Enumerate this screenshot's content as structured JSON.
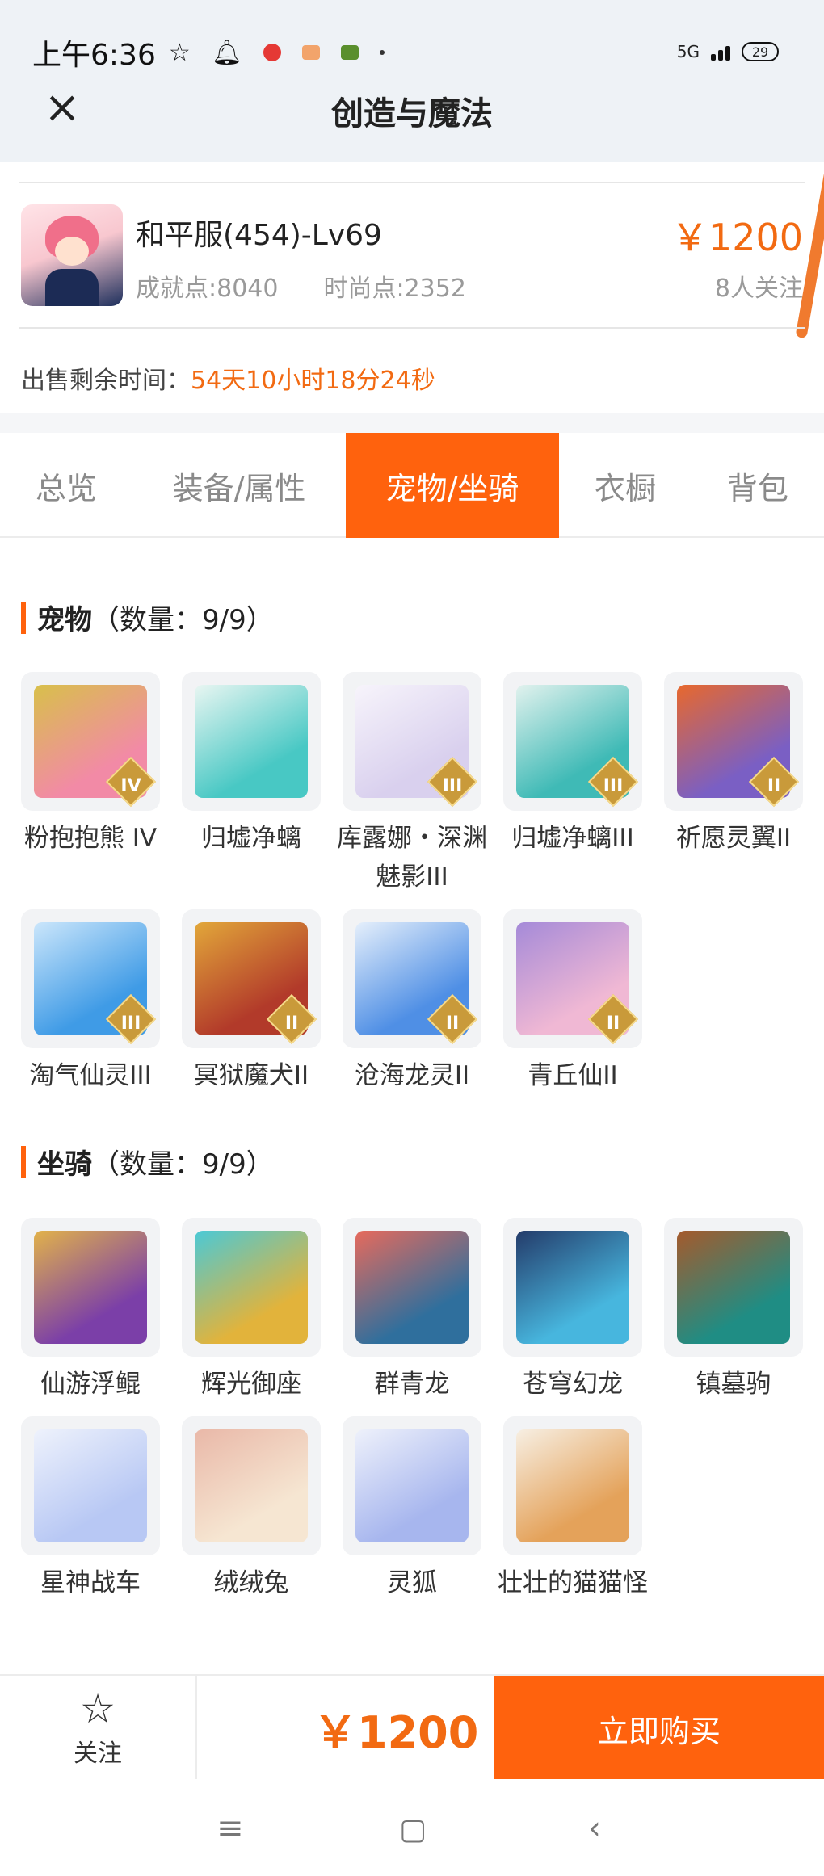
{
  "status_bar": {
    "time": "上午6:36",
    "network": "5G",
    "battery": "29"
  },
  "nav": {
    "title": "创造与魔法"
  },
  "listing": {
    "server": "和平服(454)-Lv69",
    "achievement": "成就点:8040",
    "fashion": "时尚点:2352",
    "price": "￥1200",
    "followers": "8人关注",
    "remain_label": "出售剩余时间：",
    "remain_value": "54天10小时18分24秒"
  },
  "tabs": [
    {
      "label": "总览"
    },
    {
      "label": "装备/属性"
    },
    {
      "label": "宠物/坐骑",
      "active": true
    },
    {
      "label": "衣橱"
    },
    {
      "label": "背包"
    }
  ],
  "pets": {
    "title": "宠物",
    "count": "（数量：9/9）",
    "items": [
      {
        "name": "粉抱抱熊 IV",
        "badge": "IV",
        "colors": [
          "#f28aa6",
          "#d8c04a"
        ]
      },
      {
        "name": "归墟净螭",
        "badge": "",
        "colors": [
          "#48c8c4",
          "#e9f6f2"
        ]
      },
      {
        "name": "库露娜・深渊魅影III",
        "badge": "III",
        "colors": [
          "#d9d0ee",
          "#f7f4fb"
        ]
      },
      {
        "name": "归墟净螭III",
        "badge": "III",
        "colors": [
          "#3fbab6",
          "#e2f2ee"
        ]
      },
      {
        "name": "祈愿灵翼II",
        "badge": "II",
        "colors": [
          "#7a5fc4",
          "#e8682c"
        ]
      },
      {
        "name": "淘气仙灵III",
        "badge": "III",
        "colors": [
          "#3f9be6",
          "#cbe6fb"
        ]
      },
      {
        "name": "冥狱魔犬II",
        "badge": "II",
        "colors": [
          "#b23a2a",
          "#e2a73a"
        ]
      },
      {
        "name": "沧海龙灵II",
        "badge": "II",
        "colors": [
          "#4f8fe5",
          "#e5effb"
        ]
      },
      {
        "name": "青丘仙II",
        "badge": "II",
        "colors": [
          "#f0b8d4",
          "#a58ad8"
        ]
      }
    ]
  },
  "mounts": {
    "title": "坐骑",
    "count": "（数量：9/9）",
    "items": [
      {
        "name": "仙游浮鲲",
        "colors": [
          "#7b3fa8",
          "#e2b24a"
        ]
      },
      {
        "name": "辉光御座",
        "colors": [
          "#e2b33b",
          "#4bc9d6"
        ]
      },
      {
        "name": "群青龙",
        "colors": [
          "#2f6f9d",
          "#e76a5c"
        ]
      },
      {
        "name": "苍穹幻龙",
        "colors": [
          "#47b6de",
          "#243b6a"
        ]
      },
      {
        "name": "镇墓驹",
        "colors": [
          "#1f8d84",
          "#a55a2c"
        ]
      },
      {
        "name": "星神战车",
        "colors": [
          "#b8c8f4",
          "#eef2fc"
        ]
      },
      {
        "name": "绒绒兔",
        "colors": [
          "#f6e6d2",
          "#e9b8a8"
        ]
      },
      {
        "name": "灵狐",
        "colors": [
          "#a7b6ee",
          "#eef1fb"
        ]
      },
      {
        "name": "壮壮的猫猫怪",
        "colors": [
          "#e4a25a",
          "#f7efe3"
        ]
      }
    ]
  },
  "bottom": {
    "follow_label": "关注",
    "price": "￥1200",
    "buy_label": "立即购买"
  },
  "accent_color": "#ff620d",
  "price_color": "#f26a12"
}
